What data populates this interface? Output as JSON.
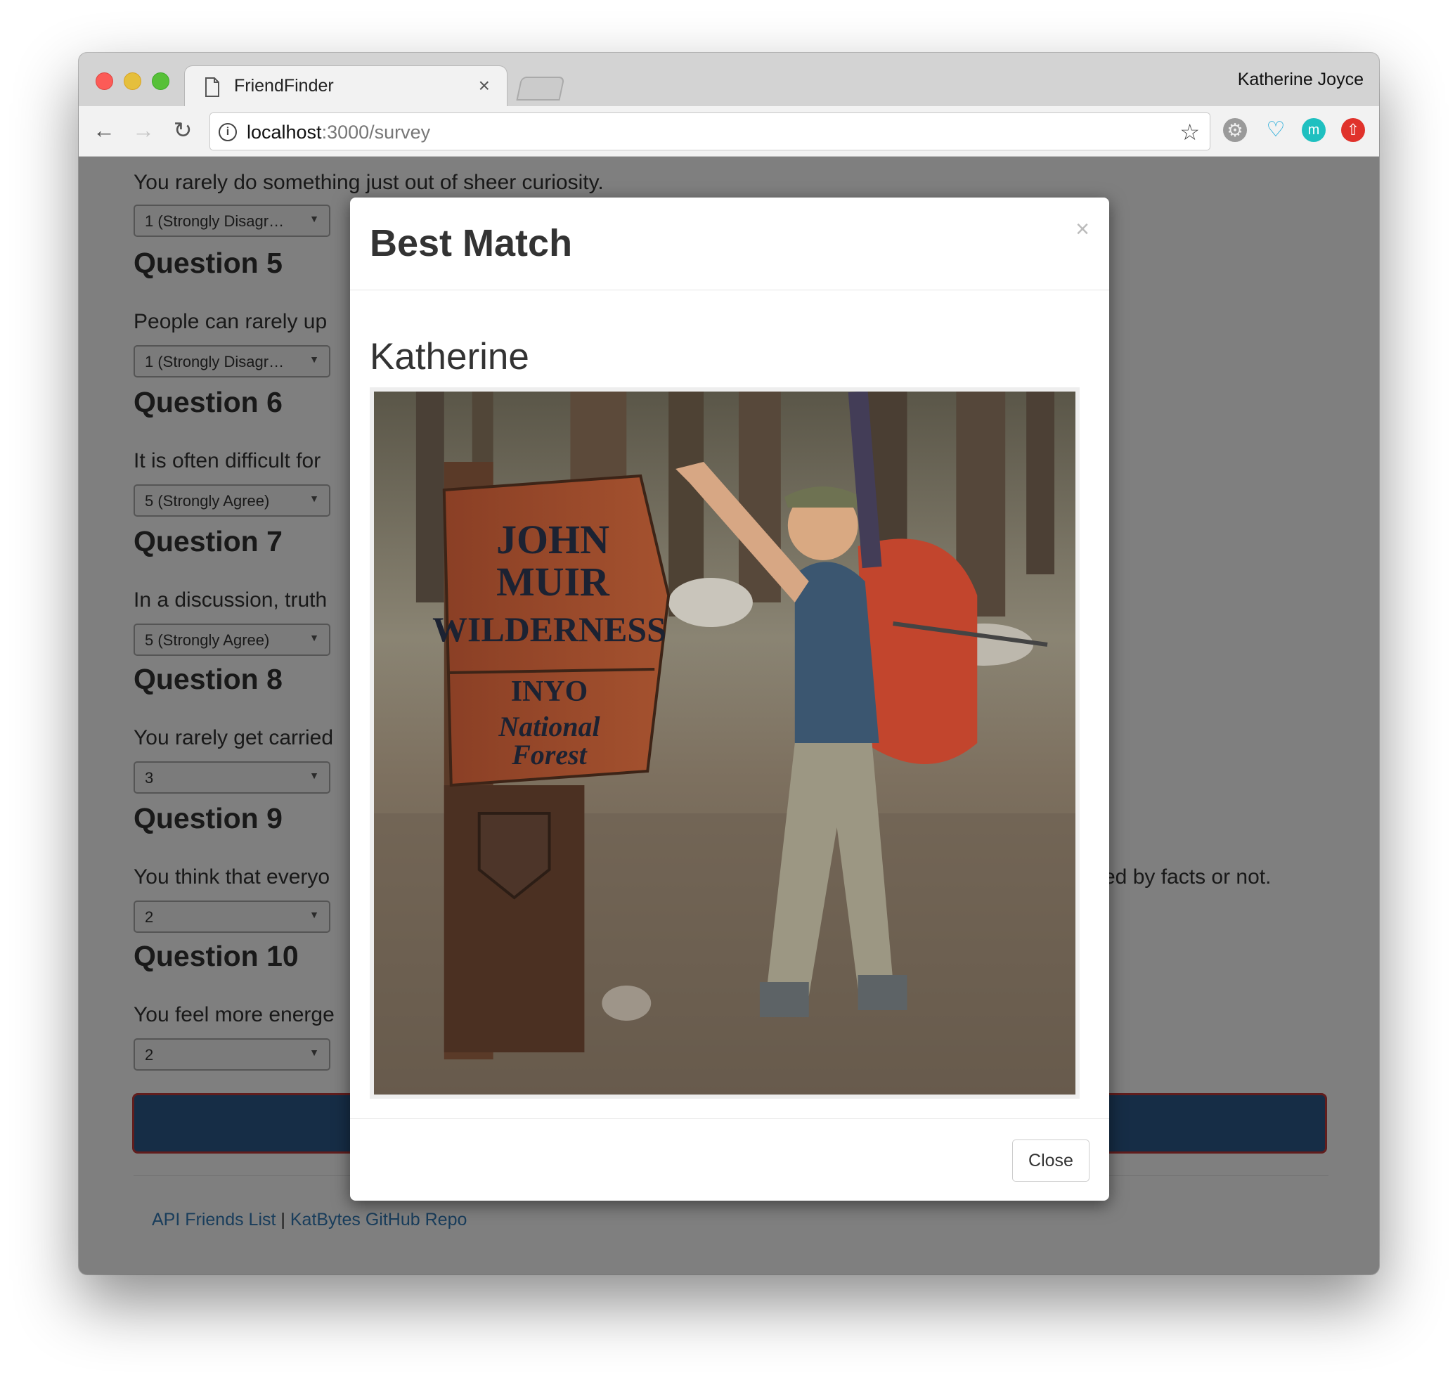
{
  "browser": {
    "tab_title": "FriendFinder",
    "tab_close": "×",
    "profile_name": "Katherine Joyce",
    "url_host": "localhost",
    "url_path": ":3000/survey"
  },
  "survey": {
    "q4_text": "You rarely do something just out of sheer curiosity.",
    "q4_value": "1 (Strongly Disagr…",
    "q5_title": "Question 5",
    "q5_text": "People can rarely up",
    "q5_value": "1 (Strongly Disagr…",
    "q6_title": "Question 6",
    "q6_text": "It is often difficult for",
    "q6_value": "5 (Strongly Agree)",
    "q7_title": "Question 7",
    "q7_text": "In a discussion, truth",
    "q7_value": "5 (Strongly Agree)",
    "q8_title": "Question 8",
    "q8_text": "You rarely get carried",
    "q8_value": "3",
    "q9_title": "Question 9",
    "q9_text": "You think that everyo",
    "q9_text_tail": "ed by facts or not.",
    "q9_value": "2",
    "q10_title": "Question 10",
    "q10_text": "You feel more energe",
    "q10_value": "2"
  },
  "footer": {
    "link_api": "API Friends List",
    "separator": "|",
    "link_repo": "KatBytes GitHub Repo"
  },
  "modal": {
    "title": "Best Match",
    "close_x": "×",
    "match_name": "Katherine",
    "close_label": "Close",
    "sign_lines": [
      "JOHN",
      "MUIR",
      "WILDERNESS",
      "INYO",
      "National",
      "Forest"
    ]
  },
  "colors": {
    "submit_fill": "#2c5a8c",
    "submit_border": "#c23a3a",
    "link": "#337ab7"
  },
  "icons": {
    "back": "arrow-left",
    "forward": "arrow-right",
    "reload": "reload",
    "info": "info",
    "bookmark": "star",
    "ext_gear": "gear",
    "ext_ghost": "ghost",
    "ext_m": "m",
    "ext_up": "arrow-up"
  }
}
